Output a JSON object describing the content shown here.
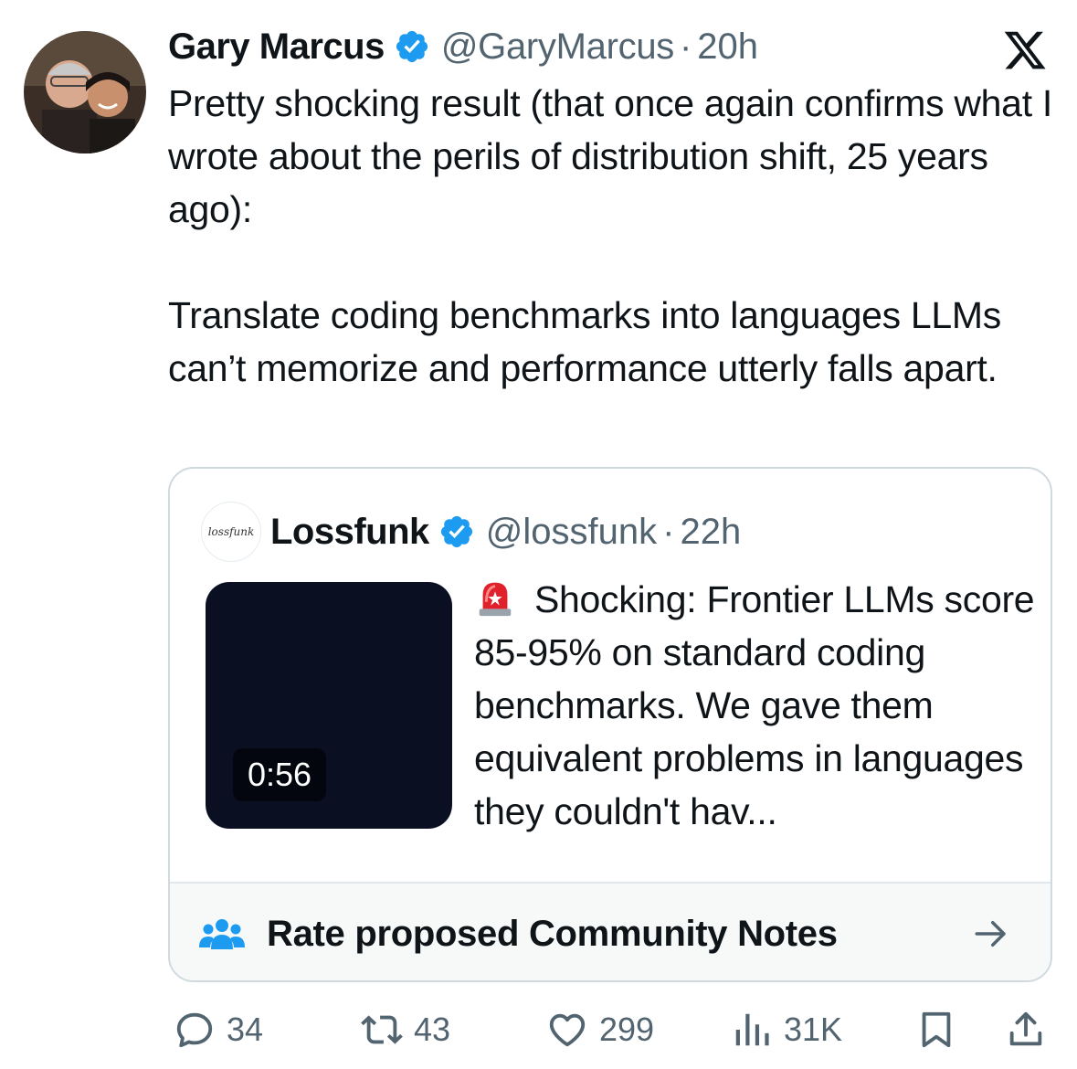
{
  "tweet": {
    "author_name": "Gary Marcus",
    "handle": "@GaryMarcus",
    "separator": "·",
    "time": "20h",
    "text_paragraph_1": "Pretty shocking result (that once again confirms what I wrote about the perils of distribution shift, 25 years ago):",
    "text_paragraph_2": "Translate coding benchmarks into languages LLMs can’t memorize and performance utterly falls apart."
  },
  "quoted_tweet": {
    "author_name": "Lossfunk",
    "handle": "@lossfunk",
    "separator": "·",
    "time": "22h",
    "avatar_text": "lossfunk",
    "text": "Shocking: Frontier LLMs score 85-95% on standard coding benchmarks. We gave them equivalent problems in languages they couldn't hav...",
    "video_duration": "0:56"
  },
  "community_notes": {
    "label": "Rate proposed Community Notes"
  },
  "actions": {
    "replies": "34",
    "reposts": "43",
    "likes": "299",
    "views": "31K"
  },
  "icons": {
    "logo": "x-logo-icon",
    "verified": "verified-badge-icon",
    "siren": "police-light-emoji-icon",
    "community": "community-people-icon",
    "arrow": "arrow-right-icon",
    "reply": "reply-icon",
    "repost": "repost-icon",
    "like": "heart-icon",
    "views": "analytics-icon",
    "bookmark": "bookmark-icon",
    "share": "share-icon"
  },
  "colors": {
    "verified_blue": "#1d9bf0",
    "text_primary": "#0f1419",
    "text_secondary": "#536471",
    "border": "#cfd9de"
  }
}
